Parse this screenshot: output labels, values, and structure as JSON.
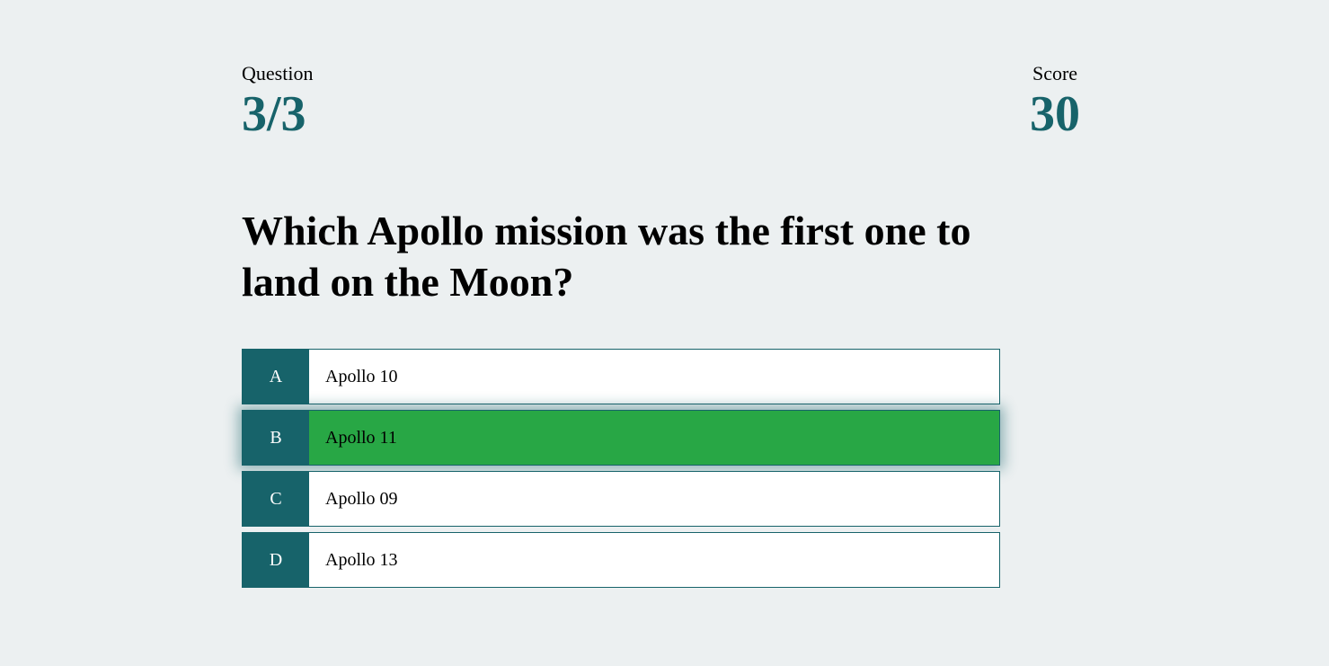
{
  "stats": {
    "question_label": "Question",
    "question_value": "3/3",
    "score_label": "Score",
    "score_value": "30"
  },
  "question": {
    "text": "Which Apollo mission was the first one to land on the Moon?"
  },
  "answers": [
    {
      "letter": "A",
      "text": "Apollo 10",
      "selected": false
    },
    {
      "letter": "B",
      "text": "Apollo 11",
      "selected": true
    },
    {
      "letter": "C",
      "text": "Apollo 09",
      "selected": false
    },
    {
      "letter": "D",
      "text": "Apollo 13",
      "selected": false
    }
  ],
  "colors": {
    "background": "#ecf0f1",
    "accent": "#17636a",
    "correct": "#28a745"
  }
}
